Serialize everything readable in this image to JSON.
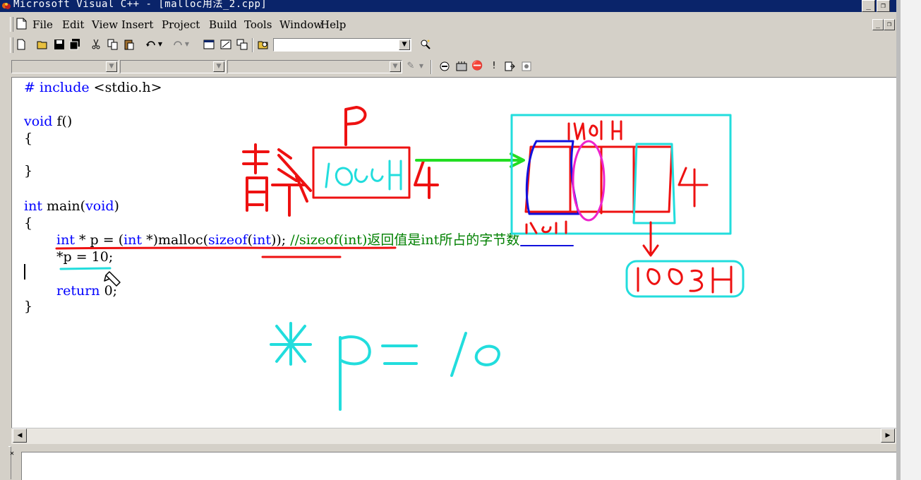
{
  "window": {
    "title": "Microsoft Visual C++ - [malloc用法_2.cpp]",
    "minimize": "_",
    "restore": "❐"
  },
  "menubar": {
    "items": [
      "File",
      "Edit",
      "View",
      "Insert",
      "Project",
      "Build",
      "Tools",
      "Window",
      "Help"
    ],
    "doc_minimize": "_",
    "doc_restore": "❐"
  },
  "toolbar1": {
    "find_combo_value": ""
  },
  "toolbar2": {
    "class_combo": "",
    "filter_combo": "",
    "members_combo": ""
  },
  "editor": {
    "lines": [
      [
        "# include <stdio.h>"
      ],
      [
        ""
      ],
      [
        "void f()"
      ],
      [
        "{"
      ],
      [
        ""
      ],
      [
        "}"
      ],
      [
        ""
      ],
      [
        "int main(void)"
      ],
      [
        "{"
      ],
      [
        "    int * p = (int *)malloc(sizeof(int)); //sizeof(int)返回值是int所占的字节数"
      ],
      [
        "    *p = 10;"
      ],
      [
        ""
      ],
      [
        "    return 0;"
      ],
      [
        "}"
      ]
    ],
    "line_include_kw": "# include",
    "line_include_rest": " <stdio.h>",
    "line_void_kw": "void",
    "line_void_rest": " f()",
    "open_brace": "{",
    "close_brace": "}",
    "line_int_kw": "int",
    "line_main_rest": " main(",
    "line_main_void": "void",
    "line_main_close": ")",
    "l10_int1": "int",
    "l10_a": " * p = (",
    "l10_int2": "int",
    "l10_b": " *)malloc(",
    "l10_sizeof": "sizeof",
    "l10_c": "(",
    "l10_int3": "int",
    "l10_d": "));",
    "l10_comment": " //sizeof(int)返回值是int所占的字节数",
    "l11": "*p = 10;",
    "l13_return": "return",
    "l13_rest": " 0;"
  },
  "annotations": {
    "p_label": "P",
    "addr_box": "1000H",
    "side_4a": "4",
    "left_chars": "静态",
    "mem_label_top": "1001H",
    "mem_label_bottom": "1002H",
    "side_4b": "4",
    "bottom_box": "1003H",
    "star_p": "*p = 10"
  },
  "colors": {
    "title_bg": "#0a246a",
    "keyword": "#0000ff",
    "comment": "#008000",
    "ink_red": "#ee1111",
    "ink_cyan": "#22dddd",
    "ink_green": "#22dd22",
    "ink_blue": "#1111dd",
    "ink_magenta": "#ee22cc"
  }
}
